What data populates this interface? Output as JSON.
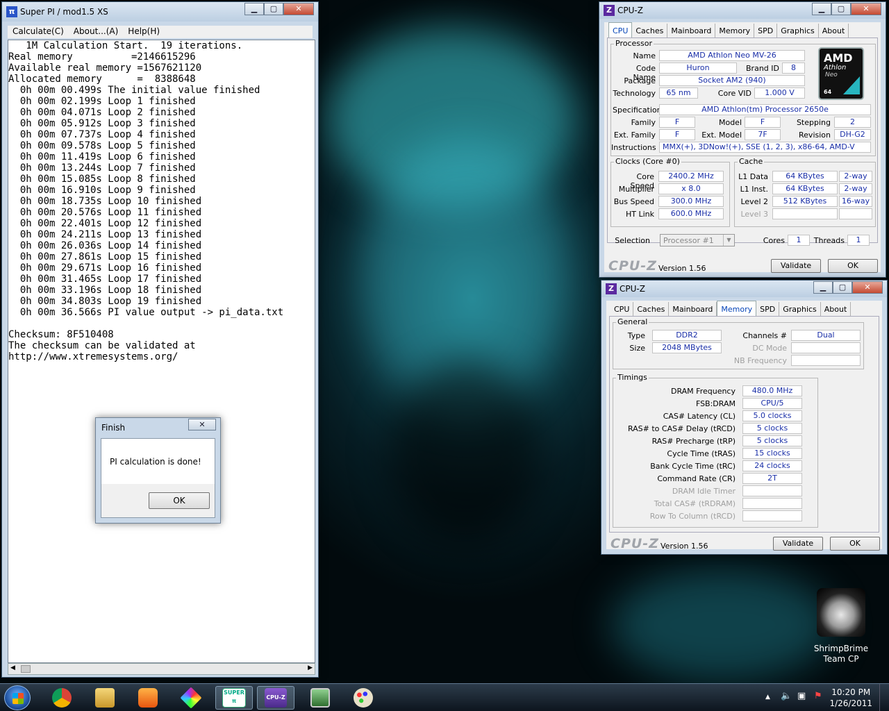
{
  "superpi": {
    "title": "Super PI / mod1.5 XS",
    "menu": [
      "Calculate(C)",
      "About...(A)",
      "Help(H)"
    ],
    "lines": [
      "   1M Calculation Start.  19 iterations.",
      "Real memory          =2146615296",
      "Available real memory =1567621120",
      "Allocated memory      =  8388648",
      "  0h 00m 00.499s The initial value finished",
      "  0h 00m 02.199s Loop 1 finished",
      "  0h 00m 04.071s Loop 2 finished",
      "  0h 00m 05.912s Loop 3 finished",
      "  0h 00m 07.737s Loop 4 finished",
      "  0h 00m 09.578s Loop 5 finished",
      "  0h 00m 11.419s Loop 6 finished",
      "  0h 00m 13.244s Loop 7 finished",
      "  0h 00m 15.085s Loop 8 finished",
      "  0h 00m 16.910s Loop 9 finished",
      "  0h 00m 18.735s Loop 10 finished",
      "  0h 00m 20.576s Loop 11 finished",
      "  0h 00m 22.401s Loop 12 finished",
      "  0h 00m 24.211s Loop 13 finished",
      "  0h 00m 26.036s Loop 14 finished",
      "  0h 00m 27.861s Loop 15 finished",
      "  0h 00m 29.671s Loop 16 finished",
      "  0h 00m 31.465s Loop 17 finished",
      "  0h 00m 33.196s Loop 18 finished",
      "  0h 00m 34.803s Loop 19 finished",
      "  0h 00m 36.566s PI value output -> pi_data.txt",
      "",
      "Checksum: 8F510408",
      "The checksum can be validated at",
      "http://www.xtremesystems.org/"
    ]
  },
  "finish_dialog": {
    "title": "Finish",
    "message": "PI calculation is done!",
    "ok": "OK",
    "close": "✕"
  },
  "cpuz_cpu": {
    "title": "CPU-Z",
    "tabs": [
      "CPU",
      "Caches",
      "Mainboard",
      "Memory",
      "SPD",
      "Graphics",
      "About"
    ],
    "processor_group": "Processor",
    "name_label": "Name",
    "name": "AMD Athlon Neo MV-26",
    "codename_label": "Code Name",
    "codename": "Huron",
    "brandid_label": "Brand ID",
    "brandid": "8",
    "package_label": "Package",
    "package": "Socket AM2 (940)",
    "technology_label": "Technology",
    "technology": "65 nm",
    "corevid_label": "Core VID",
    "corevid": "1.000 V",
    "spec_label": "Specification",
    "spec": "AMD Athlon(tm) Processor 2650e",
    "family_label": "Family",
    "family": "F",
    "model_label": "Model",
    "model": "F",
    "stepping_label": "Stepping",
    "stepping": "2",
    "extfamily_label": "Ext. Family",
    "extfamily": "F",
    "extmodel_label": "Ext. Model",
    "extmodel": "7F",
    "revision_label": "Revision",
    "revision": "DH-G2",
    "instructions_label": "Instructions",
    "instructions": "MMX(+), 3DNow!(+), SSE (1, 2, 3), x86-64, AMD-V",
    "clocks_group": "Clocks (Core #0)",
    "corespeed_label": "Core Speed",
    "corespeed": "2400.2 MHz",
    "multiplier_label": "Multiplier",
    "multiplier": "x 8.0",
    "busspeed_label": "Bus Speed",
    "busspeed": "300.0 MHz",
    "htlink_label": "HT Link",
    "htlink": "600.0 MHz",
    "cache_group": "Cache",
    "l1d_label": "L1 Data",
    "l1d": "64 KBytes",
    "l1d_way": "2-way",
    "l1i_label": "L1 Inst.",
    "l1i": "64 KBytes",
    "l1i_way": "2-way",
    "l2_label": "Level 2",
    "l2": "512 KBytes",
    "l2_way": "16-way",
    "l3_label": "Level 3",
    "selection_label": "Selection",
    "selection": "Processor #1",
    "cores_label": "Cores",
    "cores": "1",
    "threads_label": "Threads",
    "threads": "1",
    "logo": "CPU-Z",
    "version": "Version 1.56",
    "validate": "Validate",
    "ok": "OK",
    "badge_brand": "AMD",
    "badge_line1": "Athlon",
    "badge_line2": "Neo",
    "badge_line3": "64"
  },
  "cpuz_mem": {
    "title": "CPU-Z",
    "tabs": [
      "CPU",
      "Caches",
      "Mainboard",
      "Memory",
      "SPD",
      "Graphics",
      "About"
    ],
    "general_group": "General",
    "type_label": "Type",
    "type": "DDR2",
    "size_label": "Size",
    "size": "2048 MBytes",
    "channels_label": "Channels #",
    "channels": "Dual",
    "dcmode_label": "DC Mode",
    "nbfreq_label": "NB Frequency",
    "timings_group": "Timings",
    "timings": [
      {
        "label": "DRAM Frequency",
        "value": "480.0 MHz",
        "dim": false
      },
      {
        "label": "FSB:DRAM",
        "value": "CPU/5",
        "dim": false
      },
      {
        "label": "CAS# Latency (CL)",
        "value": "5.0 clocks",
        "dim": false
      },
      {
        "label": "RAS# to CAS# Delay (tRCD)",
        "value": "5 clocks",
        "dim": false
      },
      {
        "label": "RAS# Precharge (tRP)",
        "value": "5 clocks",
        "dim": false
      },
      {
        "label": "Cycle Time (tRAS)",
        "value": "15 clocks",
        "dim": false
      },
      {
        "label": "Bank Cycle Time (tRC)",
        "value": "24 clocks",
        "dim": false
      },
      {
        "label": "Command Rate (CR)",
        "value": "2T",
        "dim": false
      },
      {
        "label": "DRAM Idle Timer",
        "value": "",
        "dim": true
      },
      {
        "label": "Total CAS# (tRDRAM)",
        "value": "",
        "dim": true
      },
      {
        "label": "Row To Column (tRCD)",
        "value": "",
        "dim": true
      }
    ],
    "logo": "CPU-Z",
    "version": "Version 1.56",
    "validate": "Validate",
    "ok": "OK"
  },
  "desktop": {
    "user_line1": "ShrimpBrime",
    "user_line2": "Team CP"
  },
  "taskbar": {
    "time": "10:20 PM",
    "date": "1/26/2011",
    "superpi_icon_text": "SUPER",
    "cpuz_icon_text": "CPU-Z"
  },
  "colors": {
    "value_text": "#1a2fa8",
    "active_tab": "#0645b8"
  }
}
